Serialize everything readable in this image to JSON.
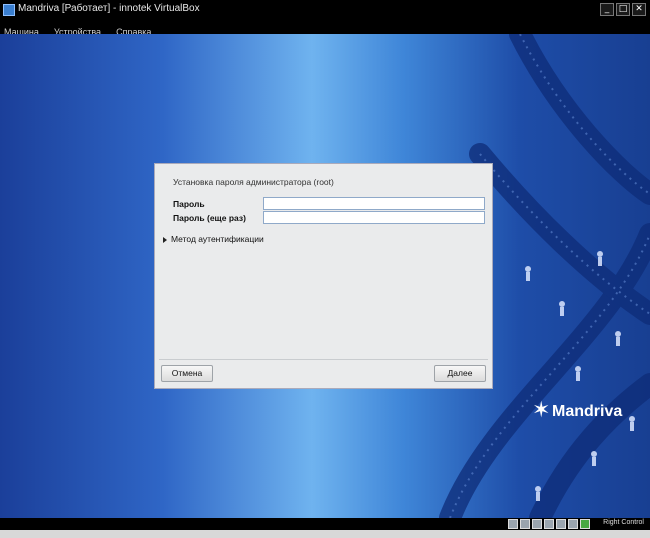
{
  "window": {
    "title": "Mandriva [Работает] - innotek VirtualBox",
    "buttons": [
      "_",
      "□",
      "✕"
    ]
  },
  "menubar": {
    "items": [
      "Машина",
      "Устройства",
      "Справка"
    ]
  },
  "dialog": {
    "title": "Установка пароля администратора (root)",
    "password_label": "Пароль",
    "password_value": "",
    "password_again_label": "Пароль (еще раз)",
    "password_again_value": "",
    "auth_expander_label": "Метод аутентификации",
    "cancel_label": "Отмена",
    "next_label": "Далее"
  },
  "branding": {
    "logo_text": "Mandriva"
  },
  "statusbar": {
    "host_key_label": "Right Control"
  },
  "colors": {
    "dialog_bg": "#eaebec",
    "desktop_center": "#6fb3ef",
    "desktop_edge": "#1b3f9a"
  }
}
